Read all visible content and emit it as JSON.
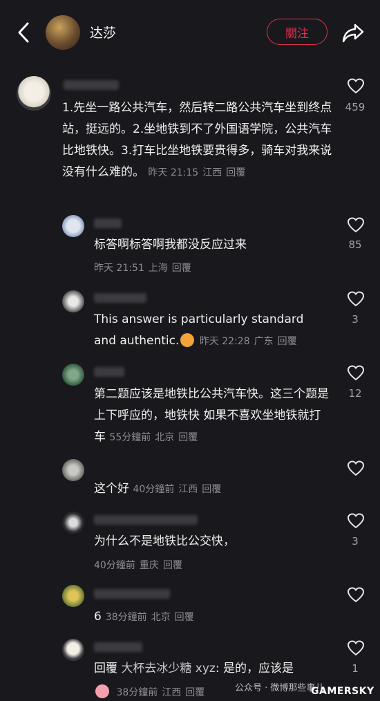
{
  "header": {
    "name": "达莎",
    "follow_label": "關注"
  },
  "comments": [
    {
      "text": "1.先坐一路公共汽车，然后转二路公共汽车坐到终点站，挺远的。2.坐地铁到不了外国语学院，公共汽车比地铁快。3.打车比坐地铁要贵得多，骑车对我来说没有什么难的。",
      "time": "昨天 21:15",
      "location": "江西",
      "reply": "回覆",
      "likes": "459"
    },
    {
      "text": "标答啊标答啊我都没反应过来",
      "time": "昨天 21:51",
      "location": "上海",
      "reply": "回覆",
      "likes": "85"
    },
    {
      "text": "This answer is particularly standard and authentic.",
      "time": "昨天 22:28",
      "location": "广东",
      "reply": "回覆",
      "likes": "3"
    },
    {
      "text": "第二题应该是地铁比公共汽车快。这三个题是上下呼应的，地铁快 如果不喜欢坐地铁就打车",
      "time": "55分鐘前",
      "location": "北京",
      "reply": "回覆",
      "likes": "12"
    },
    {
      "text": "这个好",
      "time": "40分鐘前",
      "location": "江西",
      "reply": "回覆",
      "likes": ""
    },
    {
      "text": "为什么不是地铁比公交快，",
      "time": "40分鐘前",
      "location": "重庆",
      "reply": "回覆",
      "likes": "3"
    },
    {
      "text": "6",
      "time": "38分鐘前",
      "location": "北京",
      "reply": "回覆",
      "likes": ""
    },
    {
      "reply_prefix": "回覆",
      "reply_to": "大杯去冰少糖 xyz",
      "text": ": 是的，应该是",
      "time": "38分鐘前",
      "location": "江西",
      "reply": "回覆",
      "likes": "1"
    }
  ],
  "watermark": {
    "line1": "公众号 · 微博那些事儿",
    "line2": "GAMERSKY"
  },
  "icons": [
    "back-icon",
    "share-icon",
    "heart-outline-icon"
  ],
  "colors": {
    "background": "#19191d",
    "follow": "#e2324a",
    "meta": "#8c8c92"
  }
}
